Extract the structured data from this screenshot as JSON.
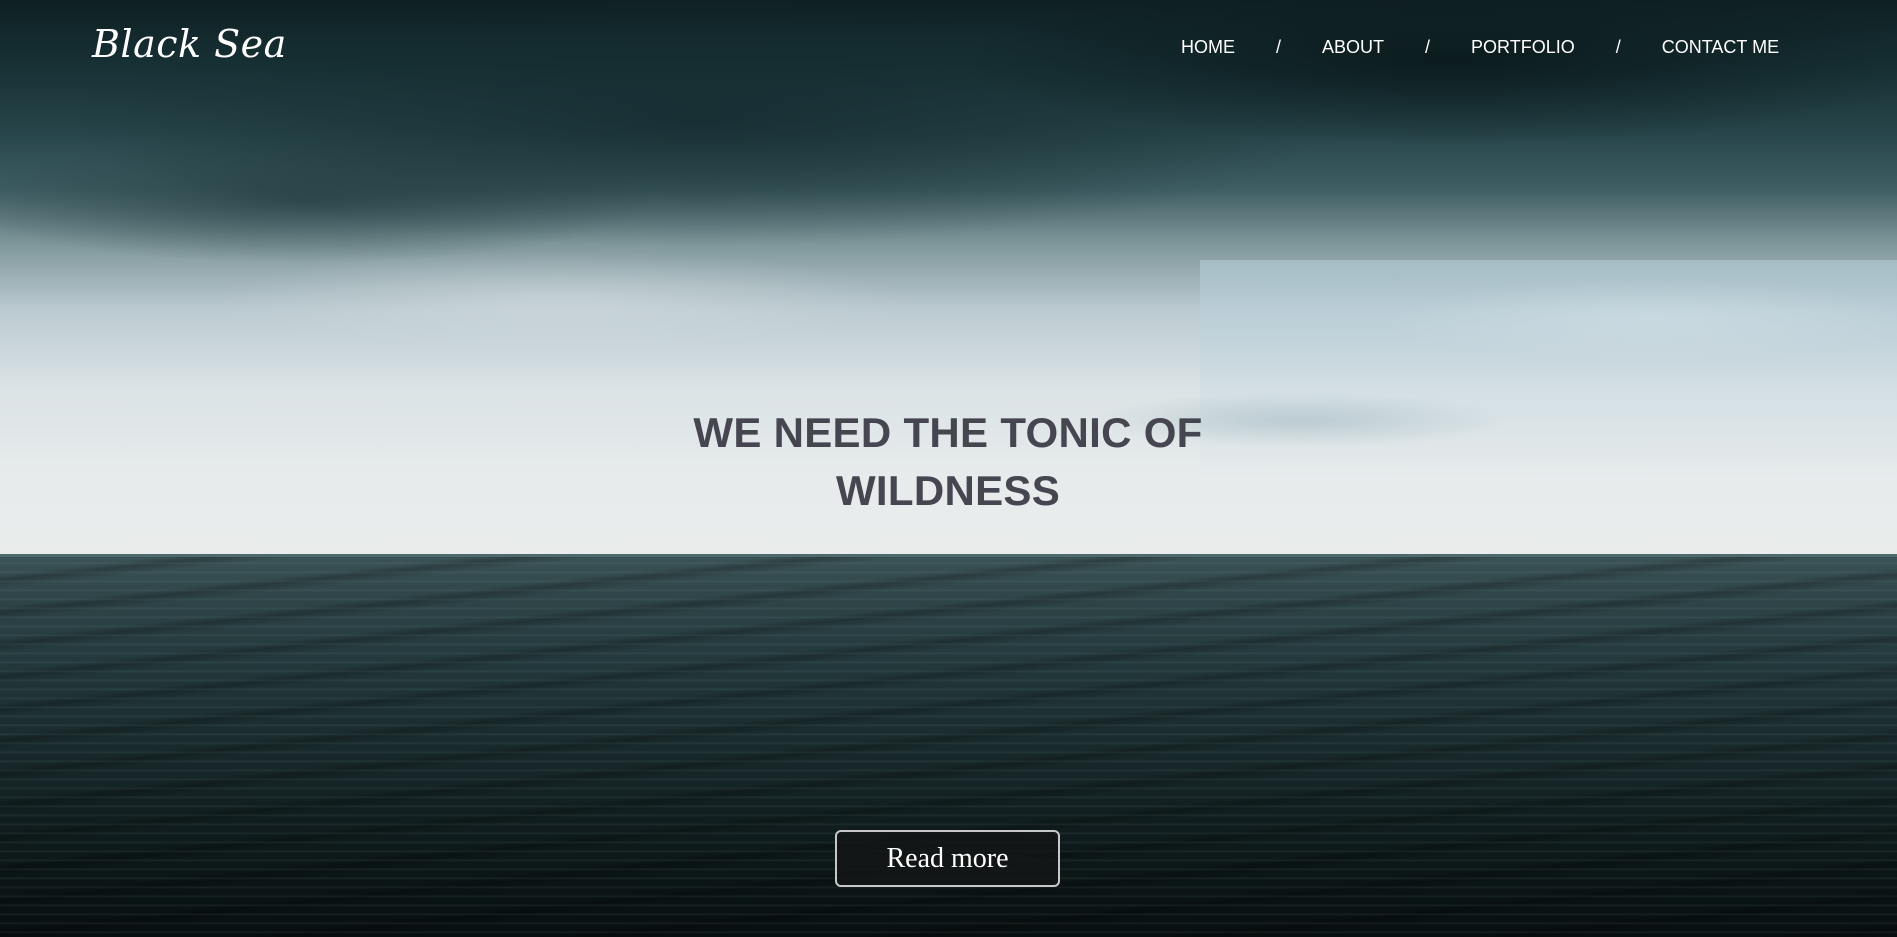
{
  "site": {
    "logo": "Black Sea"
  },
  "nav": {
    "items": [
      {
        "label": "HOME"
      },
      {
        "label": "ABOUT"
      },
      {
        "label": "PORTFOLIO"
      },
      {
        "label": "CONTACT ME"
      }
    ],
    "separator": "/"
  },
  "hero": {
    "headline_line1": "WE NEED THE TONIC OF",
    "headline_line2": "WILDNESS",
    "cta_label": "Read more"
  },
  "colors": {
    "headline": "#454650",
    "nav_text": "#ffffff",
    "button_border": "#c8c8c8"
  }
}
